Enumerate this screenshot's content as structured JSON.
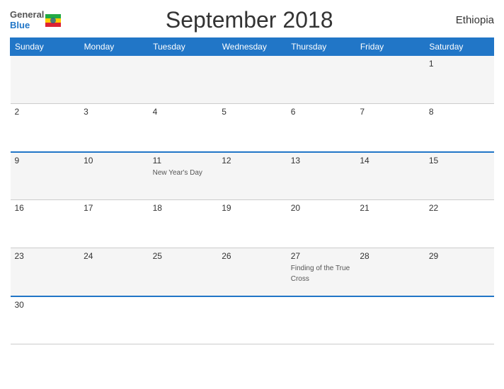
{
  "logo": {
    "general": "General",
    "blue": "Blue"
  },
  "title": "September 2018",
  "country": "Ethiopia",
  "days_header": [
    "Sunday",
    "Monday",
    "Tuesday",
    "Wednesday",
    "Thursday",
    "Friday",
    "Saturday"
  ],
  "weeks": [
    {
      "blue_top": false,
      "odd": true,
      "days": [
        {
          "num": "",
          "holiday": ""
        },
        {
          "num": "",
          "holiday": ""
        },
        {
          "num": "",
          "holiday": ""
        },
        {
          "num": "",
          "holiday": ""
        },
        {
          "num": "",
          "holiday": ""
        },
        {
          "num": "",
          "holiday": ""
        },
        {
          "num": "1",
          "holiday": ""
        }
      ]
    },
    {
      "blue_top": false,
      "odd": false,
      "days": [
        {
          "num": "2",
          "holiday": ""
        },
        {
          "num": "3",
          "holiday": ""
        },
        {
          "num": "4",
          "holiday": ""
        },
        {
          "num": "5",
          "holiday": ""
        },
        {
          "num": "6",
          "holiday": ""
        },
        {
          "num": "7",
          "holiday": ""
        },
        {
          "num": "8",
          "holiday": ""
        }
      ]
    },
    {
      "blue_top": true,
      "odd": true,
      "days": [
        {
          "num": "9",
          "holiday": ""
        },
        {
          "num": "10",
          "holiday": ""
        },
        {
          "num": "11",
          "holiday": "New Year's Day"
        },
        {
          "num": "12",
          "holiday": ""
        },
        {
          "num": "13",
          "holiday": ""
        },
        {
          "num": "14",
          "holiday": ""
        },
        {
          "num": "15",
          "holiday": ""
        }
      ]
    },
    {
      "blue_top": false,
      "odd": false,
      "days": [
        {
          "num": "16",
          "holiday": ""
        },
        {
          "num": "17",
          "holiday": ""
        },
        {
          "num": "18",
          "holiday": ""
        },
        {
          "num": "19",
          "holiday": ""
        },
        {
          "num": "20",
          "holiday": ""
        },
        {
          "num": "21",
          "holiday": ""
        },
        {
          "num": "22",
          "holiday": ""
        }
      ]
    },
    {
      "blue_top": false,
      "odd": true,
      "days": [
        {
          "num": "23",
          "holiday": ""
        },
        {
          "num": "24",
          "holiday": ""
        },
        {
          "num": "25",
          "holiday": ""
        },
        {
          "num": "26",
          "holiday": ""
        },
        {
          "num": "27",
          "holiday": "Finding of the True Cross"
        },
        {
          "num": "28",
          "holiday": ""
        },
        {
          "num": "29",
          "holiday": ""
        }
      ]
    },
    {
      "blue_top": true,
      "odd": false,
      "days": [
        {
          "num": "30",
          "holiday": ""
        },
        {
          "num": "",
          "holiday": ""
        },
        {
          "num": "",
          "holiday": ""
        },
        {
          "num": "",
          "holiday": ""
        },
        {
          "num": "",
          "holiday": ""
        },
        {
          "num": "",
          "holiday": ""
        },
        {
          "num": "",
          "holiday": ""
        }
      ]
    }
  ]
}
